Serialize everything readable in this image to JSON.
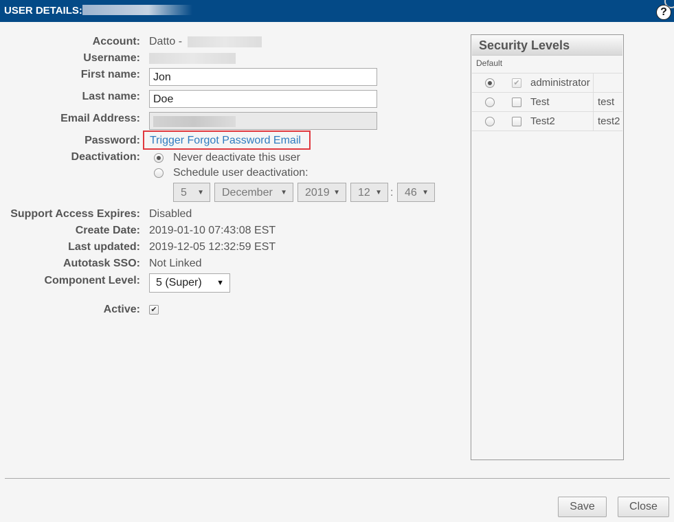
{
  "window": {
    "title": "USER DETAILS:",
    "help_icon": "?"
  },
  "fields": {
    "account_label": "Account:",
    "account_value": "Datto -",
    "username_label": "Username:",
    "first_name_label": "First name:",
    "first_name_value": "Jon",
    "last_name_label": "Last name:",
    "last_name_value": "Doe",
    "email_label": "Email Address:",
    "password_label": "Password:",
    "password_link": "Trigger Forgot Password Email",
    "deactivation_label": "Deactivation:",
    "deactivation_option_never": "Never deactivate this user",
    "deactivation_option_schedule": "Schedule user deactivation:",
    "deactivation_day": "5",
    "deactivation_month": "December",
    "deactivation_year": "2019",
    "deactivation_hour": "12",
    "deactivation_minute": "46",
    "support_access_label": "Support Access Expires:",
    "support_access_value": "Disabled",
    "create_date_label": "Create Date:",
    "create_date_value": "2019-01-10 07:43:08 EST",
    "last_updated_label": "Last updated:",
    "last_updated_value": "2019-12-05 12:32:59 EST",
    "autotask_label": "Autotask SSO:",
    "autotask_value": "Not Linked",
    "component_level_label": "Component Level:",
    "component_level_value": "5 (Super)",
    "active_label": "Active:"
  },
  "security": {
    "title": "Security Levels",
    "default_header": "Default",
    "levels": [
      {
        "name": "administrator",
        "alias": "",
        "default": true,
        "checked": true
      },
      {
        "name": "Test",
        "alias": "test",
        "default": false,
        "checked": false
      },
      {
        "name": "Test2",
        "alias": "test2",
        "default": false,
        "checked": false
      }
    ]
  },
  "buttons": {
    "save": "Save",
    "close": "Close"
  },
  "colors": {
    "titlebar": "#044a87",
    "link": "#2f7cc0",
    "highlight": "#e0383e"
  }
}
